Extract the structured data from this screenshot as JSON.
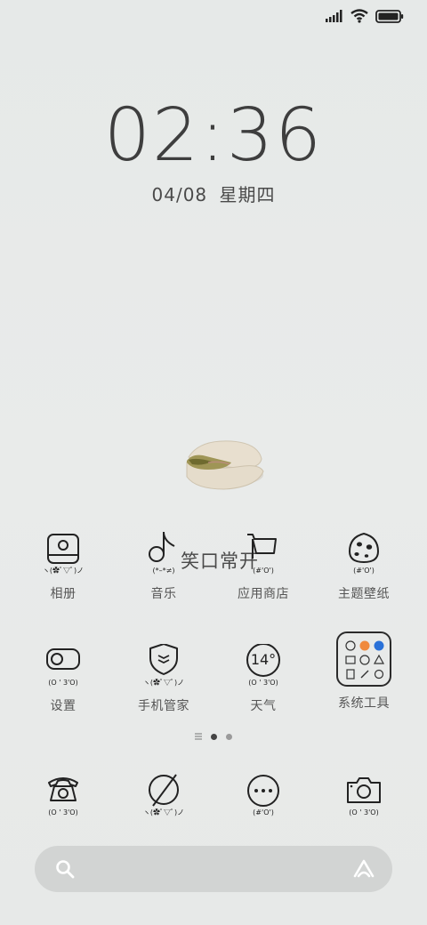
{
  "status_bar": {
    "signal_icon": "signal-icon",
    "wifi_icon": "wifi-icon",
    "battery_icon": "battery-icon"
  },
  "lockclock": {
    "time": "02:36",
    "date": "04/08",
    "weekday": "星期四"
  },
  "overlay_text": "笑口常开",
  "apps_row1": [
    {
      "label": "相册",
      "face": "ヽ(✿ﾟ▽ﾟ)ノ",
      "icon": "gallery-icon"
    },
    {
      "label": "音乐",
      "face": "(*–*≠)",
      "icon": "music-icon"
    },
    {
      "label": "应用商店",
      "face": "(#'O')",
      "icon": "shopping-cart-icon"
    },
    {
      "label": "主题壁纸",
      "face": "(#'O')",
      "icon": "egg-icon"
    }
  ],
  "apps_row2": [
    {
      "label": "设置",
      "face": "(O ' 3'O)",
      "icon": "toggle-settings-icon"
    },
    {
      "label": "手机管家",
      "face": "ヽ(✿ﾟ▽ﾟ)ノ",
      "icon": "shield-icon"
    },
    {
      "label": "天气",
      "face": "(O ' 3'O)",
      "icon": "weather-icon",
      "temperature": "14°"
    },
    {
      "label": "系统工具",
      "icon": "folder-icon"
    }
  ],
  "dock": [
    {
      "face": "(O ' 3'O)",
      "icon": "phone-icon"
    },
    {
      "face": "ヽ(✿ﾟ▽ﾟ)ノ",
      "icon": "browser-planet-icon"
    },
    {
      "face": "(#'O')",
      "icon": "messages-icon"
    },
    {
      "face": "(O ' 3'O)",
      "icon": "camera-icon"
    }
  ],
  "search": {
    "placeholder": "",
    "search_icon": "search-icon",
    "assistant_icon": "assistant-icon"
  },
  "page_indicator": {
    "pages": 3,
    "current": 2
  }
}
